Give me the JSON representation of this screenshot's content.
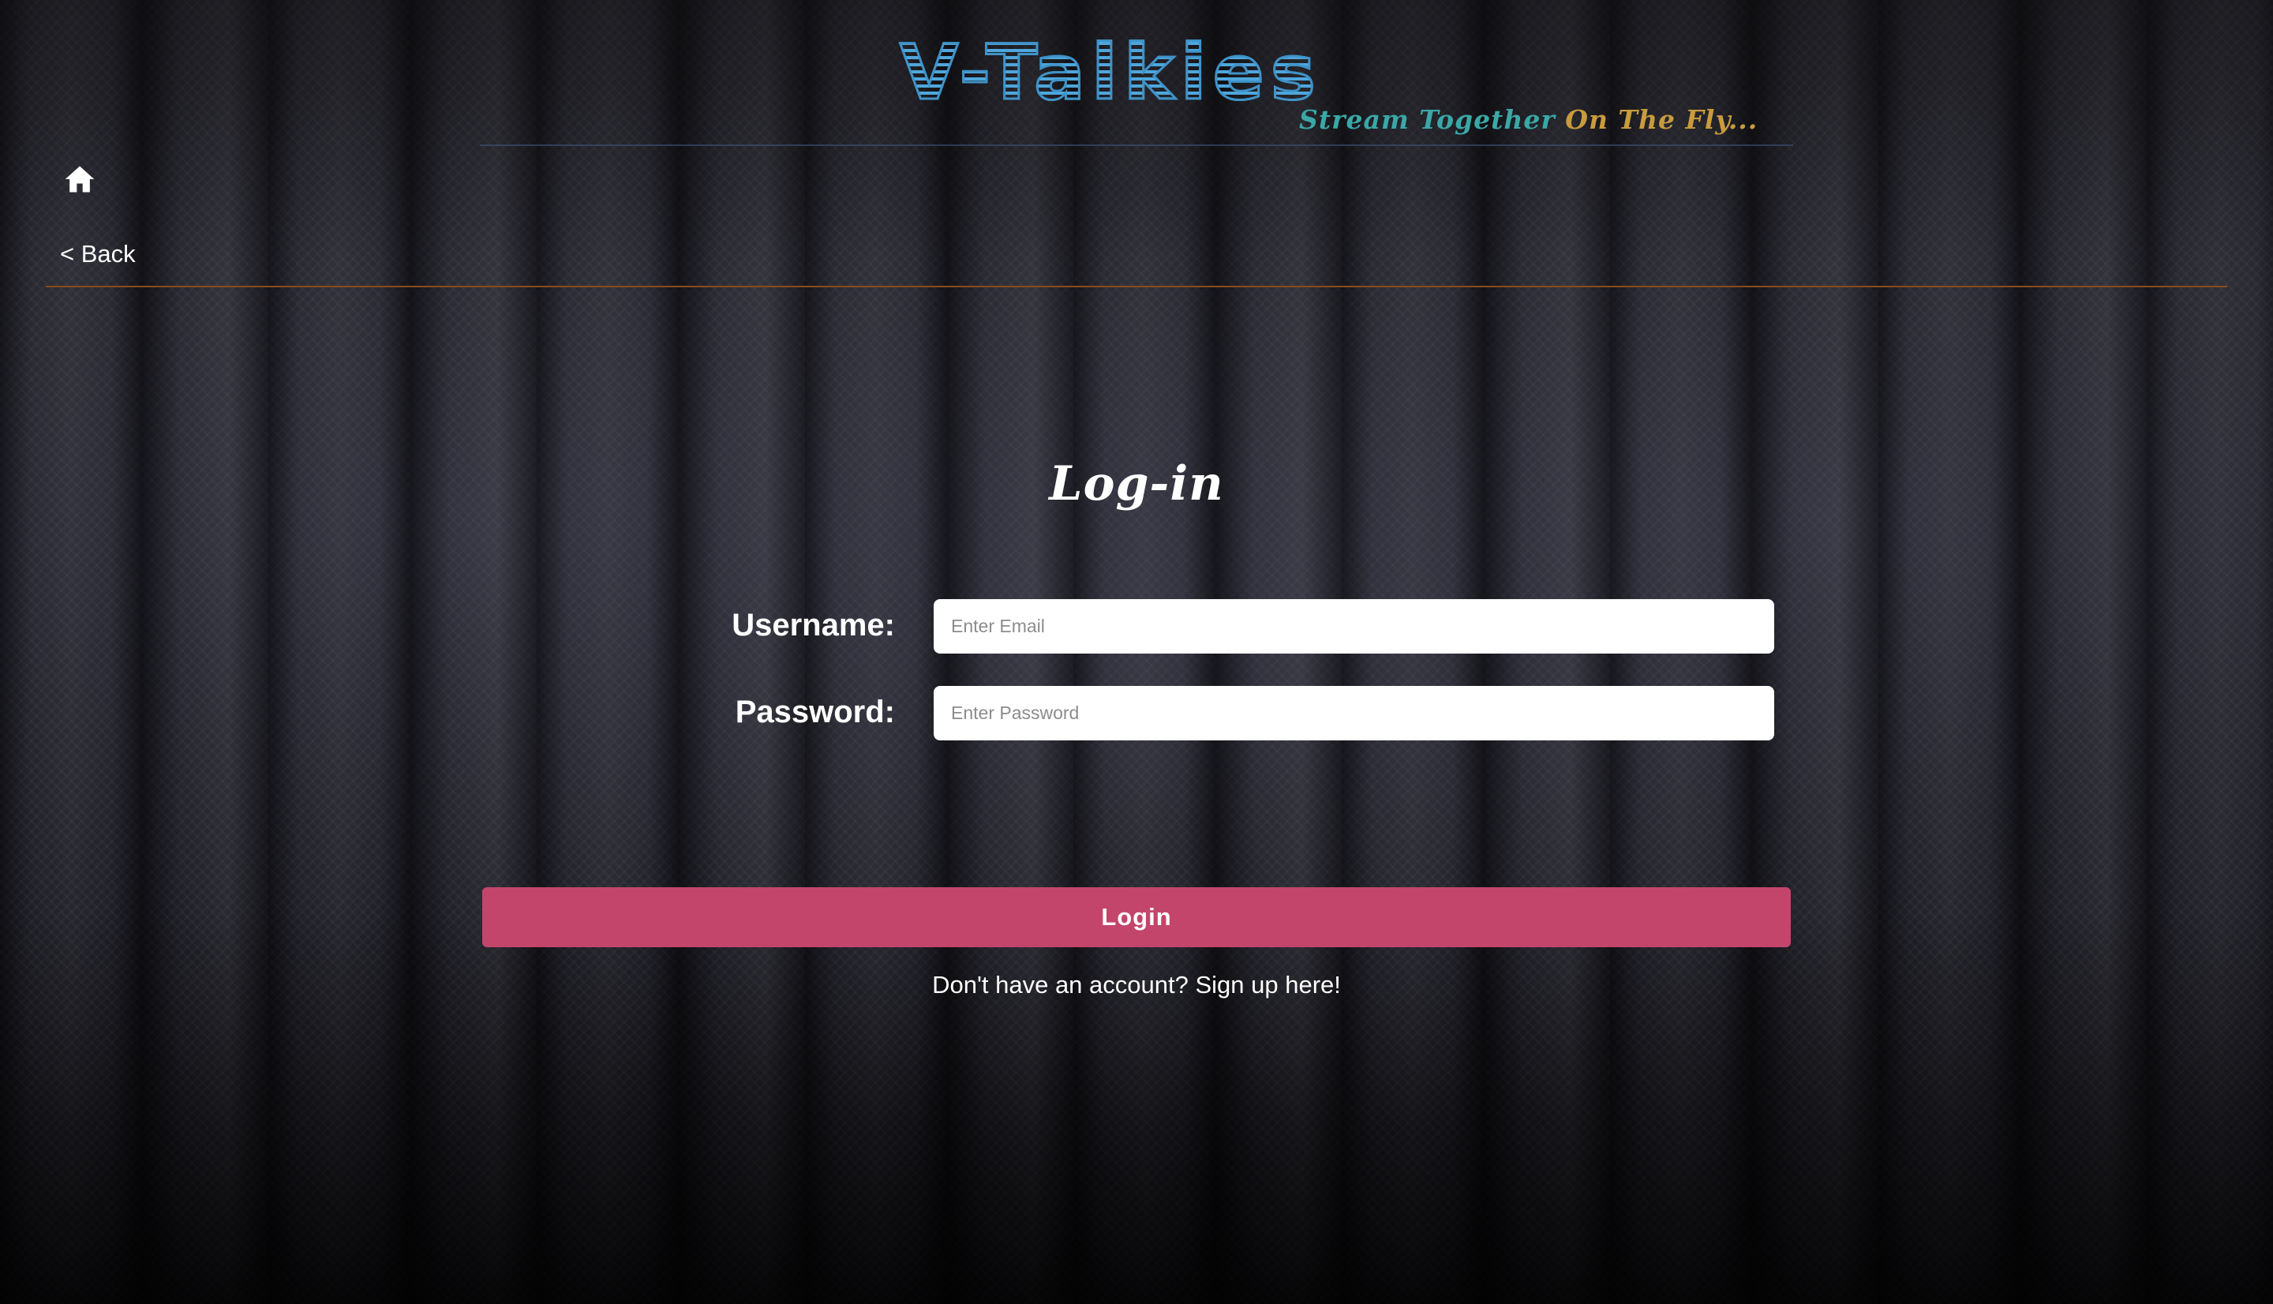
{
  "header": {
    "logo_text": "V-Talkies",
    "tagline_part1": "Stream Together ",
    "tagline_part2": "On The Fly..."
  },
  "nav": {
    "home_icon": "home-icon",
    "back_label": "< Back"
  },
  "login": {
    "title": "Log-in",
    "username_label": "Username:",
    "username_placeholder": "Enter Email",
    "password_label": "Password:",
    "password_placeholder": "Enter Password",
    "submit_label": "Login",
    "signup_text": "Don't have an account? Sign up here!"
  },
  "colors": {
    "logo": "#4ea7dd",
    "tagline_teal": "#3aa8a6",
    "tagline_gold": "#c89b3c",
    "button": "#c4456c",
    "nav_rule": "#8a4a1a"
  }
}
